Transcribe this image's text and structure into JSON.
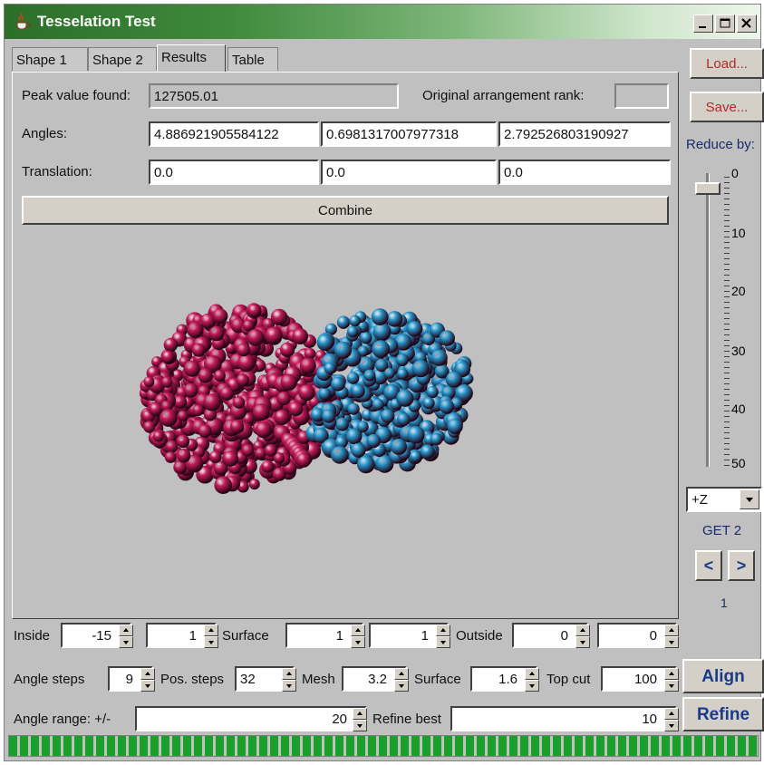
{
  "window": {
    "title": "Tesselation Test",
    "controls": [
      "minimize-icon",
      "maximize-icon",
      "close-icon"
    ]
  },
  "tabs": [
    {
      "label": "Shape 1",
      "active": false
    },
    {
      "label": "Shape 2",
      "active": false
    },
    {
      "label": "Results",
      "active": true
    },
    {
      "label": "Table",
      "active": false
    }
  ],
  "results": {
    "peak_label": "Peak value found:",
    "peak_value": "127505.01",
    "rank_label": "Original arrangement rank:",
    "rank_value": "",
    "angles_label": "Angles:",
    "angles": [
      "4.886921905584122",
      "0.6981317007977318",
      "2.792526803190927"
    ],
    "translation_label": "Translation:",
    "translation": [
      "0.0",
      "0.0",
      "0.0"
    ],
    "combine_label": "Combine"
  },
  "viewer": {
    "shape1_color": "#c81e5c",
    "shape2_color": "#2a9ad0"
  },
  "sidebar": {
    "load_label": "Load...",
    "save_label": "Save...",
    "reduce_label": "Reduce by:",
    "slider_value": 0,
    "slider_ticks": [
      "0",
      "10",
      "20",
      "30",
      "40",
      "50"
    ],
    "axis_select": "+Z",
    "get_label": "GET 2",
    "prev_label": "<",
    "next_label": ">",
    "page_value": "1"
  },
  "params": {
    "inside_label": "Inside",
    "inside_value1": "-15",
    "inside_value2": "1",
    "surface_label": "Surface",
    "surface_value1": "1",
    "surface_value2": "1",
    "outside_label": "Outside",
    "outside_value1": "0",
    "outside_value2": "0",
    "angle_steps_label": "Angle steps",
    "angle_steps_value": "9",
    "pos_steps_label": "Pos. steps",
    "pos_steps_value": "32",
    "mesh_label": "Mesh",
    "mesh_value": "3.2",
    "surface2_label": "Surface",
    "surface2_value": "1.6",
    "top_cut_label": "Top cut",
    "top_cut_value": "100",
    "angle_range_label": "Angle range: +/-",
    "angle_range_value": "20",
    "refine_best_label": "Refine best",
    "refine_best_value": "10"
  },
  "actions": {
    "align_label": "Align",
    "refine_label": "Refine"
  },
  "progress": {
    "fraction": 1.0,
    "color": "#17a02a"
  }
}
